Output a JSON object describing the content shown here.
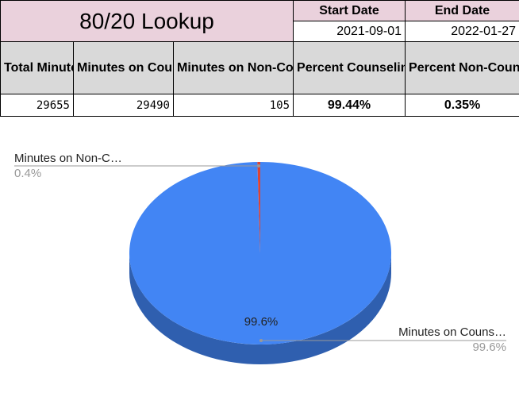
{
  "sheet": {
    "title": "80/20 Lookup",
    "start_date_label": "Start Date",
    "end_date_label": "End Date",
    "start_date": "2021-09-01",
    "end_date": "2022-01-27",
    "headers": {
      "total_minutes": "Total Minutes",
      "minutes_counseling": "Minutes on Counseling Tasks",
      "minutes_non_counseling": "Minutes on Non-Counseling Tasks",
      "percent_counseling": "Percent Counseling",
      "percent_non_counseling": "Percent Non-Counseling"
    },
    "values": {
      "total_minutes": "29655",
      "minutes_counseling": "29490",
      "minutes_non_counseling": "105",
      "percent_counseling": "99.44%",
      "percent_non_counseling": "0.35%"
    }
  },
  "chart_data": {
    "type": "pie",
    "style": "3d",
    "slices": [
      {
        "name": "Minutes on Counseling Tasks",
        "value": 29490,
        "color": "#4285f4",
        "side_color": "#2f5faf"
      },
      {
        "name": "Minutes on Non-Counseling Tasks",
        "value": 105,
        "color": "#db4437",
        "side_color": "#a8342a"
      }
    ],
    "labels": {
      "counseling_name": "Minutes on Couns…",
      "counseling_pct": "99.6%",
      "non_counseling_name": "Minutes on Non-C…",
      "non_counseling_pct": "0.4%",
      "inner_label": "99.6%"
    }
  }
}
